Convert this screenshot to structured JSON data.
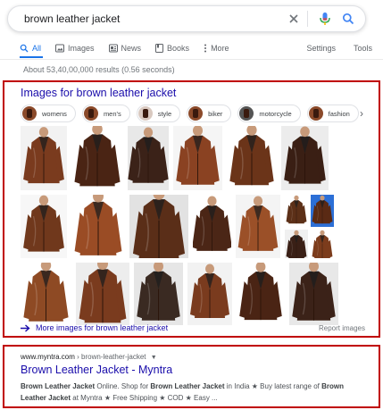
{
  "search": {
    "query": "brown leather jacket",
    "clear_icon": "close-icon",
    "voice_icon": "mic-icon",
    "search_icon": "search-icon"
  },
  "tabs": [
    {
      "label": "All",
      "icon": "search-icon",
      "active": true
    },
    {
      "label": "Images",
      "icon": "image-icon"
    },
    {
      "label": "News",
      "icon": "news-icon"
    },
    {
      "label": "Books",
      "icon": "book-icon"
    },
    {
      "label": "More",
      "icon": "more-vert-icon"
    }
  ],
  "tools": {
    "settings": "Settings",
    "tools": "Tools"
  },
  "stats": "About 53,40,00,000 results (0.56 seconds)",
  "images_section": {
    "title": "Images for brown leather jacket",
    "chips": [
      "womens",
      "men's",
      "style",
      "biker",
      "motorcycle",
      "fashion"
    ],
    "more_link": "More images for brown leather jacket",
    "report": "Report images"
  },
  "result": {
    "domain": "www.myntra.com",
    "crumb": "› brown-leather-jacket",
    "title": "Brown Leather Jacket - Myntra",
    "snippet": {
      "b1": "Brown Leather Jacket",
      "t1": " Online. Shop for ",
      "b2": "Brown Leather Jacket",
      "t2": " in India ★ Buy latest range of ",
      "b3": "Brown Leather Jacket",
      "t3": " at Myntra ★ Free Shipping ★ COD ★ Easy ..."
    }
  },
  "colors": {
    "accent": "#1a73e8",
    "link": "#1a0dab",
    "highlight_border": "#c00000"
  }
}
